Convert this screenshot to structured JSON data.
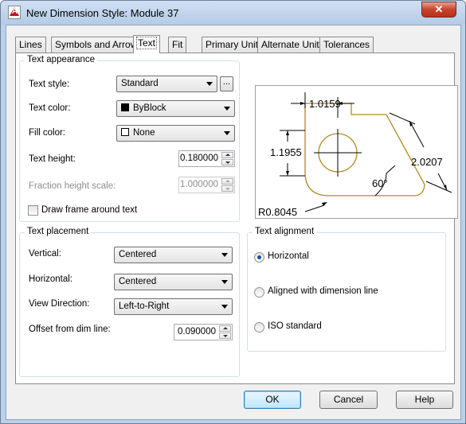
{
  "window": {
    "title": "New Dimension Style: Module 37",
    "close_glyph": "✕",
    "app_icon": "autocad-icon"
  },
  "tabs": [
    {
      "label": "Lines"
    },
    {
      "label": "Symbols and Arrows"
    },
    {
      "label": "Text"
    },
    {
      "label": "Fit"
    },
    {
      "label": "Primary Units"
    },
    {
      "label": "Alternate Units"
    },
    {
      "label": "Tolerances"
    }
  ],
  "text_appearance": {
    "group_title": "Text appearance",
    "text_style": {
      "label": "Text style:",
      "value": "Standard",
      "browse_label": "..."
    },
    "text_color": {
      "label": "Text color:",
      "value": "ByBlock",
      "swatch": "#000000"
    },
    "fill_color": {
      "label": "Fill color:",
      "value": "None",
      "swatch": "#ffffff"
    },
    "text_height": {
      "label": "Text height:",
      "value": "0.180000"
    },
    "fraction_height_scale": {
      "label": "Fraction height scale:",
      "value": "1.000000"
    },
    "draw_frame": {
      "label": "Draw frame around text",
      "checked": false
    }
  },
  "preview": {
    "dim_top": "1.0159",
    "dim_left": "1.1955",
    "dim_right": "2.0207",
    "dim_angle": "60°",
    "dim_radius": "R0.8045",
    "outline_color": "#b08a20"
  },
  "text_placement": {
    "group_title": "Text placement",
    "vertical": {
      "label": "Vertical:",
      "value": "Centered"
    },
    "horizontal": {
      "label": "Horizontal:",
      "value": "Centered"
    },
    "view_direction": {
      "label": "View Direction:",
      "value": "Left-to-Right"
    },
    "offset": {
      "label": "Offset from dim line:",
      "value": "0.090000"
    }
  },
  "text_alignment": {
    "group_title": "Text alignment",
    "options": [
      {
        "label": "Horizontal",
        "checked": true
      },
      {
        "label": "Aligned with dimension line",
        "checked": false
      },
      {
        "label": "ISO standard",
        "checked": false
      }
    ]
  },
  "buttons": {
    "ok": "OK",
    "cancel": "Cancel",
    "help": "Help"
  }
}
